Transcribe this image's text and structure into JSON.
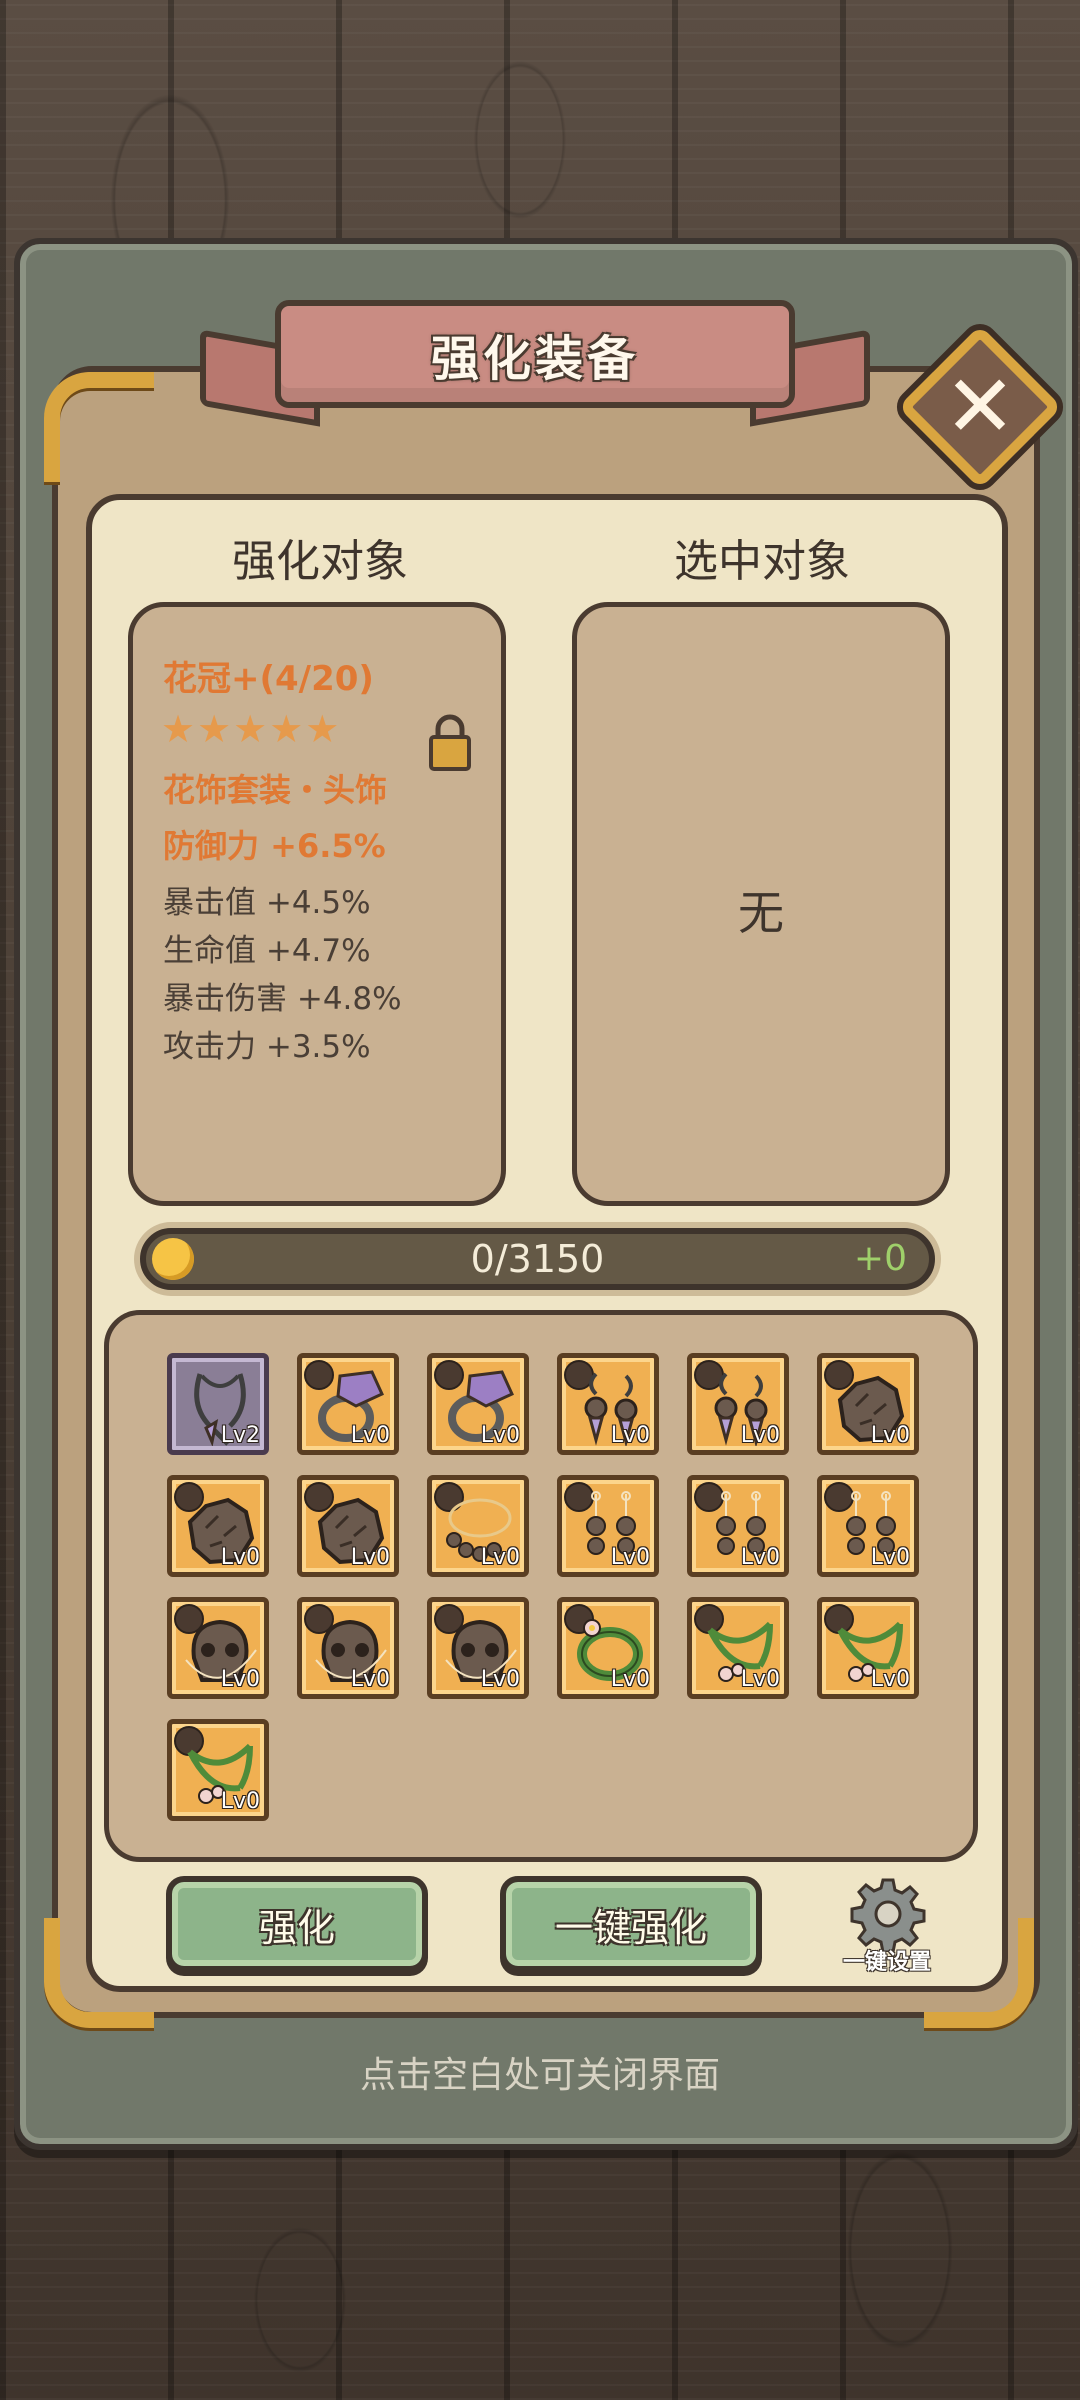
{
  "title": "强化装备",
  "columns": {
    "left_title": "强化对象",
    "right_title": "选中对象"
  },
  "target": {
    "name": "花冠+(4/20)",
    "stars": "★★★★★",
    "set": "花饰套装・头饰",
    "main_stat": "防御力 +6.5%",
    "sub_stats": [
      "暴击值 +4.5%",
      "生命值 +4.7%",
      "暴击伤害 +4.8%",
      "攻击力 +3.5%"
    ]
  },
  "selected": {
    "text": "无"
  },
  "progress": {
    "text": "0/3150",
    "gain": "+0",
    "value": 0,
    "max": 3150
  },
  "items": [
    {
      "kind": "necklace",
      "level": "Lv2",
      "rarity": "purple"
    },
    {
      "kind": "ring",
      "level": "Lv0",
      "rarity": "orange"
    },
    {
      "kind": "ring",
      "level": "Lv0",
      "rarity": "orange"
    },
    {
      "kind": "earring",
      "level": "Lv0",
      "rarity": "orange"
    },
    {
      "kind": "earring",
      "level": "Lv0",
      "rarity": "orange"
    },
    {
      "kind": "rock",
      "level": "Lv0",
      "rarity": "orange"
    },
    {
      "kind": "rock",
      "level": "Lv0",
      "rarity": "orange"
    },
    {
      "kind": "rock",
      "level": "Lv0",
      "rarity": "orange"
    },
    {
      "kind": "beads",
      "level": "Lv0",
      "rarity": "orange"
    },
    {
      "kind": "pendants",
      "level": "Lv0",
      "rarity": "orange"
    },
    {
      "kind": "pendants",
      "level": "Lv0",
      "rarity": "orange"
    },
    {
      "kind": "pendants",
      "level": "Lv0",
      "rarity": "orange"
    },
    {
      "kind": "skull",
      "level": "Lv0",
      "rarity": "orange"
    },
    {
      "kind": "skull",
      "level": "Lv0",
      "rarity": "orange"
    },
    {
      "kind": "skull",
      "level": "Lv0",
      "rarity": "orange"
    },
    {
      "kind": "wreath",
      "level": "Lv0",
      "rarity": "orange"
    },
    {
      "kind": "vine",
      "level": "Lv0",
      "rarity": "orange"
    },
    {
      "kind": "vine",
      "level": "Lv0",
      "rarity": "orange"
    },
    {
      "kind": "vine",
      "level": "Lv0",
      "rarity": "orange"
    }
  ],
  "buttons": {
    "enhance": "强化",
    "one_key_enhance": "一键强化",
    "settings": "一键设置"
  },
  "hint": "点击空白处可关闭界面",
  "colors": {
    "accent_orange": "#e07934",
    "button_green": "#8db48a",
    "gold": "#d9a540"
  }
}
